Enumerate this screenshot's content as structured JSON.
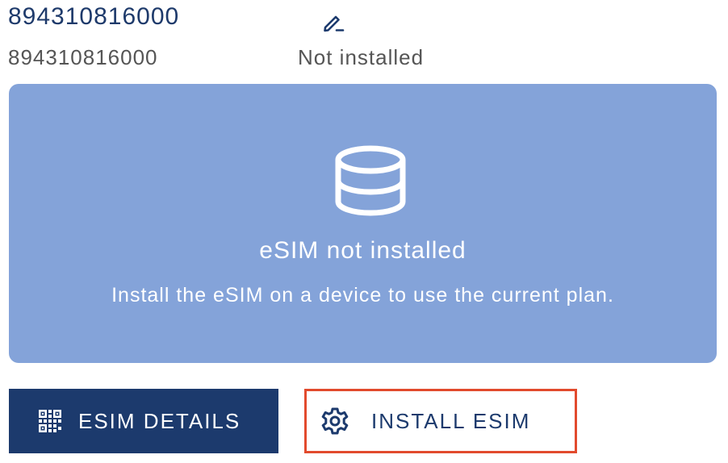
{
  "esim": {
    "title": "894310816000",
    "subtitle": "894310816000",
    "status": "Not installed"
  },
  "notice": {
    "icon": "database-icon",
    "title": "eSIM not installed",
    "description": "Install the eSIM on a device to use the current plan."
  },
  "actions": {
    "details_label": "ESIM DETAILS",
    "details_icon": "qr-code-icon",
    "install_label": "INSTALL ESIM",
    "install_icon": "gear-icon"
  },
  "colors": {
    "primary": "#1c3a6d",
    "card": "#84a3d9",
    "highlight": "#e24a2d"
  }
}
